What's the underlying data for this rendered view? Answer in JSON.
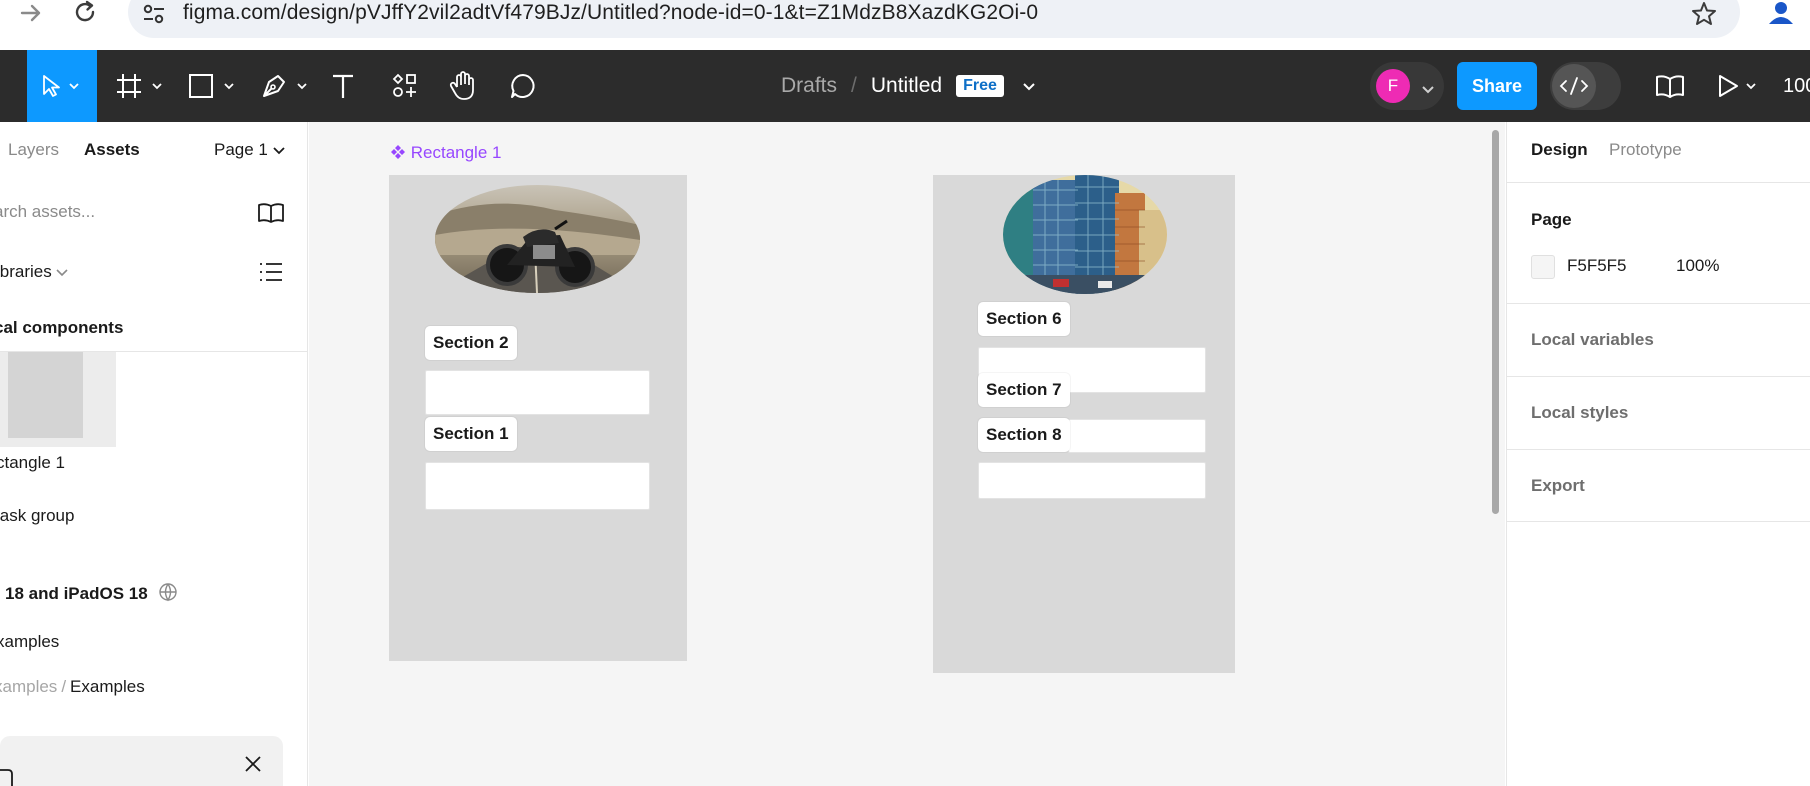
{
  "browser": {
    "url": "figma.com/design/pVJffY2vil2adtVf479BJz/Untitled?node-id=0-1&t=Z1MdzB8XazdKG2Oi-0",
    "icons": [
      "forward-arrow-icon",
      "reload-icon",
      "site-settings-icon",
      "bookmark-star-icon",
      "profile-icon"
    ]
  },
  "toolbar": {
    "tools": [
      "move-tool",
      "frame-tool",
      "shape-tool",
      "pen-tool",
      "text-tool",
      "resources-tool",
      "hand-tool",
      "comment-tool"
    ],
    "breadcrumb_drafts": "Drafts",
    "breadcrumb_sep": "/",
    "file_title": "Untitled",
    "plan_badge": "Free",
    "avatar_initial": "F",
    "share_label": "Share",
    "zoom": "100"
  },
  "left_panel": {
    "tab_layers": "Layers",
    "tab_assets": "Assets",
    "page_selector": "Page 1",
    "search_placeholder": "arch assets...",
    "libraries": "ibraries",
    "local_components": "cal components",
    "component_name": "ctangle 1",
    "mask_group": "lask group",
    "ios_library": "18 and iPadOS 18",
    "examples": "xamples",
    "crumb_muted": "xamples",
    "crumb_sep": "/",
    "crumb_strong": "Examples"
  },
  "canvas": {
    "component_label": "Rectangle 1",
    "frame_left_sections": [
      "Section 2",
      "Section 1"
    ],
    "frame_right_sections": [
      "Section 6",
      "Section 7",
      "Section 8"
    ],
    "colors": {
      "canvas": "#F5F5F5",
      "frame": "#D9D9D9",
      "component": "#9747FF"
    }
  },
  "right_panel": {
    "tab_design": "Design",
    "tab_prototype": "Prototype",
    "page_heading": "Page",
    "page_color": "F5F5F5",
    "page_opacity": "100%",
    "local_variables": "Local variables",
    "local_styles": "Local styles",
    "export": "Export"
  },
  "accent_colors": {
    "figma_blue": "#0D99FF",
    "avatar_pink": "#EE2BB4",
    "toolbar": "#2C2C2C"
  }
}
